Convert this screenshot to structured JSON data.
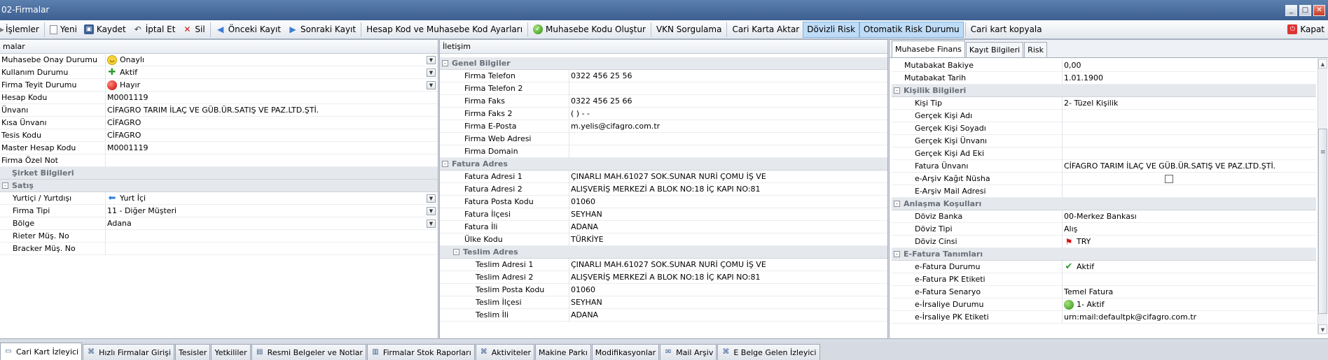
{
  "window": {
    "title": "02-Firmalar"
  },
  "toolbar": {
    "islemler": "İşlemler",
    "yeni": "Yeni",
    "kaydet": "Kaydet",
    "iptal": "İptal Et",
    "sil": "Sil",
    "onceki": "Önceki Kayıt",
    "sonraki": "Sonraki Kayıt",
    "hesap_kod": "Hesap Kod ve Muhasebe Kod Ayarları",
    "muh_kodu": "Muhasebe Kodu Oluştur",
    "vkn": "VKN Sorgulama",
    "cari_aktar": "Cari Karta Aktar",
    "dovizli_risk": "Dövizli Risk",
    "oto_risk": "Otomatik Risk Durumu",
    "cari_kopyala": "Cari kart kopyala",
    "kapat": "Kapat"
  },
  "left": {
    "header": "malar",
    "rows": [
      {
        "k": "Muhasebe Onay Durumu",
        "v": "Onaylı",
        "icon": "smiley-icon",
        "dd": true
      },
      {
        "k": "Kullanım Durumu",
        "v": "Aktif",
        "icon": "puzzle-icon",
        "dd": true
      },
      {
        "k": "Firma Teyit Durumu",
        "v": "Hayır",
        "icon": "red-ball-icon",
        "dd": true
      },
      {
        "k": "Hesap Kodu",
        "v": "M0001119"
      },
      {
        "k": "Ünvanı",
        "v": "CİFAGRO TARIM İLAÇ VE GÜB.ÜR.SATIŞ VE PAZ.LTD.ŞTİ."
      },
      {
        "k": "Kısa Ünvanı",
        "v": "CİFAGRO"
      },
      {
        "k": "Tesis Kodu",
        "v": "CİFAGRO"
      },
      {
        "k": "Master Hesap Kodu",
        "v": "M0001119"
      },
      {
        "k": "Firma Özel Not",
        "v": ""
      }
    ],
    "cat_sirket": "Şirket Bilgileri",
    "cat_satis": "Satış",
    "satis_rows": [
      {
        "k": "Yurtiçi / Yurtdışı",
        "v": "Yurt İçi",
        "icon": "arrow-left-icon",
        "dd": true
      },
      {
        "k": "Firma Tipi",
        "v": "11 - Diğer Müşteri",
        "dd": true
      },
      {
        "k": "Bölge",
        "v": "Adana",
        "dd": true
      },
      {
        "k": "Rieter Müş. No",
        "v": ""
      },
      {
        "k": "Bracker Müş. No",
        "v": ""
      }
    ]
  },
  "mid": {
    "header": "İletişim",
    "cat_genel": "Genel Bilgiler",
    "genel_rows": [
      {
        "k": "Firma Telefon",
        "v": "0322 456 25 56"
      },
      {
        "k": "Firma Telefon 2",
        "v": ""
      },
      {
        "k": "Firma Faks",
        "v": "0322  456 25 66"
      },
      {
        "k": "Firma Faks 2",
        "v": "(   )   -  -"
      },
      {
        "k": "Firma E-Posta",
        "v": "m.yelis@cifagro.com.tr"
      },
      {
        "k": "Firma Web Adresi",
        "v": ""
      },
      {
        "k": "Firma Domain",
        "v": ""
      }
    ],
    "cat_fatura": "Fatura Adres",
    "fatura_rows": [
      {
        "k": "Fatura Adresi 1",
        "v": "ÇINARLI MAH.61027 SOK.SUNAR NURİ ÇOMU İŞ VE"
      },
      {
        "k": "Fatura Adresi 2",
        "v": "ALIŞVERİŞ MERKEZİ A BLOK NO:18 İÇ KAPI NO:81"
      },
      {
        "k": "Fatura Posta Kodu",
        "v": "01060"
      },
      {
        "k": "Fatura İlçesi",
        "v": "SEYHAN"
      },
      {
        "k": "Fatura İli",
        "v": "ADANA"
      },
      {
        "k": "Ülke Kodu",
        "v": "TÜRKİYE"
      }
    ],
    "cat_teslim": "Teslim Adres",
    "teslim_rows": [
      {
        "k": "Teslim Adresi 1",
        "v": "ÇINARLI MAH.61027 SOK.SUNAR NURİ ÇOMU İŞ VE"
      },
      {
        "k": "Teslim Adresi 2",
        "v": "ALIŞVERİŞ MERKEZİ A BLOK NO:18 İÇ KAPI NO:81"
      },
      {
        "k": "Teslim Posta Kodu",
        "v": "01060"
      },
      {
        "k": "Teslim İlçesi",
        "v": "SEYHAN"
      },
      {
        "k": "Teslim İli",
        "v": "ADANA"
      }
    ]
  },
  "right": {
    "tabs": [
      "Muhasebe Finans",
      "Kayıt Bilgileri",
      "Risk"
    ],
    "top_rows": [
      {
        "k": "Mutabakat Bakiye",
        "v": "0,00"
      },
      {
        "k": "Mutabakat Tarih",
        "v": "1.01.1900"
      }
    ],
    "cat_kisilik": "Kişilik Bilgileri",
    "kisilik_rows": [
      {
        "k": "Kişi Tip",
        "v": "2- Tüzel Kişilik"
      },
      {
        "k": "Gerçek Kişi Adı",
        "v": ""
      },
      {
        "k": "Gerçek Kişi Soyadı",
        "v": ""
      },
      {
        "k": "Gerçek Kişi Ünvanı",
        "v": ""
      },
      {
        "k": "Gerçek Kişi Ad Eki",
        "v": ""
      },
      {
        "k": "Fatura Ünvanı",
        "v": "CİFAGRO TARIM İLAÇ VE GÜB.ÜR.SATIŞ VE PAZ.LTD.ŞTİ."
      },
      {
        "k": "e-Arşiv Kağıt Nüsha",
        "v": "",
        "checkbox": true
      },
      {
        "k": "E-Arşiv Mail Adresi",
        "v": ""
      }
    ],
    "cat_anlasma": "Anlaşma Koşulları",
    "anlasma_rows": [
      {
        "k": "Döviz Banka",
        "v": "00-Merkez Bankası"
      },
      {
        "k": "Döviz Tipi",
        "v": "Alış"
      },
      {
        "k": "Döviz Cinsi",
        "v": "TRY",
        "icon": "flag-icon"
      }
    ],
    "cat_efatura": "E-Fatura Tanımları",
    "efatura_rows": [
      {
        "k": "e-Fatura Durumu",
        "v": "Aktif",
        "icon": "check-icon"
      },
      {
        "k": "e-Fatura PK Etiketi",
        "v": ""
      },
      {
        "k": "e-Fatura Senaryo",
        "v": "Temel Fatura"
      },
      {
        "k": "e-İrsaliye Durumu",
        "v": "1- Aktif",
        "icon": "green-ball-icon"
      },
      {
        "k": "e-İrsaliye PK Etiketi",
        "v": "urn:mail:defaultpk@cifagro.com.tr"
      }
    ]
  },
  "bottom_tabs": [
    {
      "label": "Cari Kart İzleyici",
      "active": true
    },
    {
      "label": "Hızlı Firmalar Girişi"
    },
    {
      "label": "Tesisler"
    },
    {
      "label": "Yetkililer"
    },
    {
      "label": "Resmi Belgeler ve Notlar"
    },
    {
      "label": "Firmalar Stok Raporları"
    },
    {
      "label": "Aktiviteler"
    },
    {
      "label": "Makine Parkı"
    },
    {
      "label": "Modifikasyonlar"
    },
    {
      "label": "Mail Arşiv"
    },
    {
      "label": "E Belge Gelen İzleyici"
    }
  ]
}
